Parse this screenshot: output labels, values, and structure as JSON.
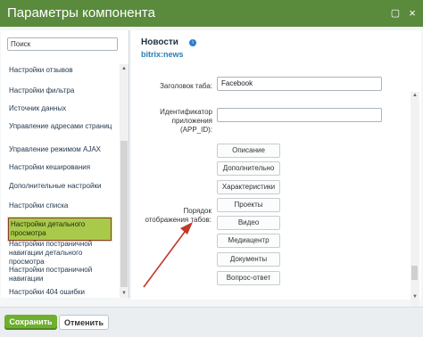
{
  "window": {
    "title": "Параметры компонента",
    "buttons": [
      "maximize-icon",
      "close-icon"
    ]
  },
  "sidebar": {
    "search": {
      "value": "Поиск"
    },
    "items": [
      {
        "label": "Настройки отзывов"
      },
      {
        "label": "Настройки фильтра"
      },
      {
        "label": "Источник данных"
      },
      {
        "label": "Управление адресами страниц"
      },
      {
        "label": "Управление режимом AJAX"
      },
      {
        "label": "Настройки кеширования"
      },
      {
        "label": "Дополнительные настройки"
      },
      {
        "label": "Настройки списка"
      },
      {
        "label": "Настройки детального просмотра",
        "active": true
      },
      {
        "label": "Настройки постраничной навигации детального просмотра"
      },
      {
        "label": "Настройки постраничной навигации"
      },
      {
        "label": "Настройки 404 ошибки"
      }
    ]
  },
  "main": {
    "component_title": "Новости",
    "component_id": "bitrix:news",
    "fields": {
      "tab_title_label": "Заголовок таба:",
      "tab_title_value": "Facebook",
      "app_id_label_line1": "Идентификатор",
      "app_id_label_line2": "приложения",
      "app_id_label_line3": "(APP_ID):",
      "app_id_value": "",
      "tab_order_label_line1": "Порядок",
      "tab_order_label_line2": "отображения табов:"
    },
    "tab_order_buttons": [
      "Описание",
      "Дополнительно",
      "Характеристики",
      "Проекты",
      "Видео",
      "Медиацентр",
      "Документы",
      "Вопрос-ответ"
    ]
  },
  "footer": {
    "save_label": "Сохранить",
    "cancel_label": "Отменить"
  },
  "colors": {
    "titlebar": "#5a8a3c",
    "active_item": "#a9c94a",
    "save_button": "#6fae2f",
    "arrow": "#c0392b"
  }
}
